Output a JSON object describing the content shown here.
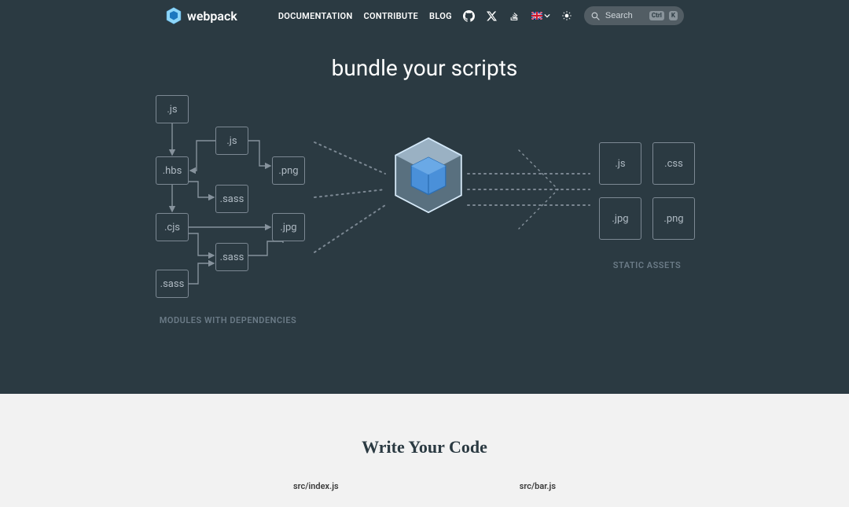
{
  "brand": "webpack",
  "nav": {
    "documentation": "DOCUMENTATION",
    "contribute": "CONTRIBUTE",
    "blog": "BLOG"
  },
  "search": {
    "placeholder": "Search",
    "shortcut1": "Ctrl",
    "shortcut2": "K"
  },
  "hero": {
    "prefix": "bundle your ",
    "dynamic": "scripts"
  },
  "modules": {
    "js1": ".js",
    "js2": ".js",
    "hbs": ".hbs",
    "png1": ".png",
    "sass1": ".sass",
    "cjs": ".cjs",
    "jpg": ".jpg",
    "sass2": ".sass",
    "sass3": ".sass"
  },
  "assets": {
    "js": ".js",
    "css": ".css",
    "jpg": ".jpg",
    "png": ".png"
  },
  "labels": {
    "modules": "MODULES WITH DEPENDENCIES",
    "assets": "STATIC ASSETS"
  },
  "band": {
    "title": "Write Your Code",
    "file1": "src/index.js",
    "file2": "src/bar.js"
  }
}
